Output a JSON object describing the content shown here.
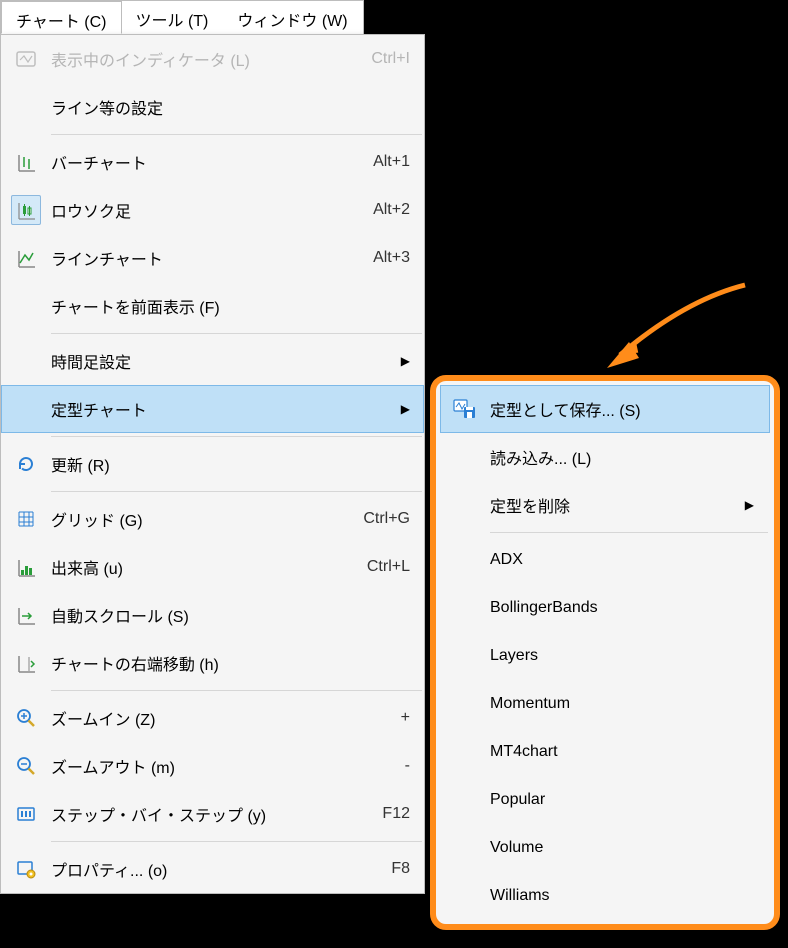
{
  "menubar": {
    "items": [
      {
        "label": "チャート (C)"
      },
      {
        "label": "ツール (T)"
      },
      {
        "label": "ウィンドウ (W)"
      }
    ]
  },
  "menu": {
    "indicators": {
      "label": "表示中のインディケータ (L)",
      "shortcut": "Ctrl+I"
    },
    "lines": {
      "label": "ライン等の設定"
    },
    "barchart": {
      "label": "バーチャート",
      "shortcut": "Alt+1"
    },
    "candlestick": {
      "label": "ロウソク足",
      "shortcut": "Alt+2"
    },
    "linechart": {
      "label": "ラインチャート",
      "shortcut": "Alt+3"
    },
    "foreground": {
      "label": "チャートを前面表示 (F)"
    },
    "timeframe": {
      "label": "時間足設定"
    },
    "template": {
      "label": "定型チャート"
    },
    "refresh": {
      "label": "更新 (R)"
    },
    "grid": {
      "label": "グリッド (G)",
      "shortcut": "Ctrl+G"
    },
    "volume": {
      "label": "出来高 (u)",
      "shortcut": "Ctrl+L"
    },
    "autoscroll": {
      "label": "自動スクロール (S)"
    },
    "shift": {
      "label": "チャートの右端移動 (h)"
    },
    "zoomin": {
      "label": "ズームイン (Z)",
      "shortcut": "+"
    },
    "zoomout": {
      "label": "ズームアウト (m)",
      "shortcut": "-"
    },
    "step": {
      "label": "ステップ・バイ・ステップ (y)",
      "shortcut": "F12"
    },
    "properties": {
      "label": "プロパティ... (o)",
      "shortcut": "F8"
    }
  },
  "submenu": {
    "save": {
      "label": "定型として保存... (S)"
    },
    "load": {
      "label": "読み込み... (L)"
    },
    "delete": {
      "label": "定型を削除"
    },
    "templates": [
      "ADX",
      "BollingerBands",
      "Layers",
      "Momentum",
      "MT4chart",
      "Popular",
      "Volume",
      "Williams"
    ]
  }
}
